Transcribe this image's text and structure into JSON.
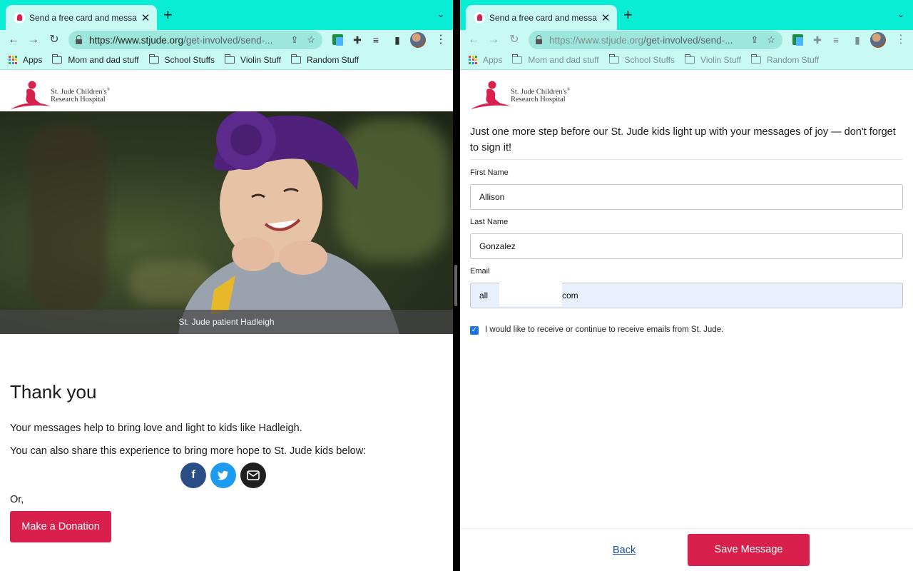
{
  "browser": {
    "tab_title": "Send a free card and message",
    "url_host": "https://www.stjude.org",
    "url_path": "/get-involved/send-...",
    "bookmarks": [
      "Apps",
      "Mom and dad stuff",
      "School Stuffs",
      "Violin Stuff",
      "Random Stuff"
    ]
  },
  "brand": {
    "line1": "St. Jude Children's",
    "line2": "Research Hospital",
    "mark": "®"
  },
  "left": {
    "hero_caption": "St. Jude patient Hadleigh",
    "title": "Thank you",
    "message": "Your messages help to bring love and light to kids like Hadleigh.",
    "share_prompt": "You can also share this experience to bring more hope to St. Jude kids below:",
    "or_label": "Or,",
    "donate_label": "Make a Donation"
  },
  "right": {
    "heading": "Just one more step before our St. Jude kids light up with your messages of joy — don't forget to sign it!",
    "first_name_label": "First Name",
    "first_name_value": "Allison",
    "last_name_label": "Last Name",
    "last_name_value": "Gonzalez",
    "email_label": "Email",
    "email_value_prefix": "all",
    "email_value_suffix": "com",
    "opt_in_label": "I would like to receive or continue to receive emails from St. Jude.",
    "opt_in_checked": true,
    "back_label": "Back",
    "save_label": "Save Message"
  },
  "colors": {
    "brand_red": "#d91f4b",
    "chrome_teal": "#09edd4",
    "facebook": "#2b4d86",
    "twitter": "#1d9bf0"
  }
}
